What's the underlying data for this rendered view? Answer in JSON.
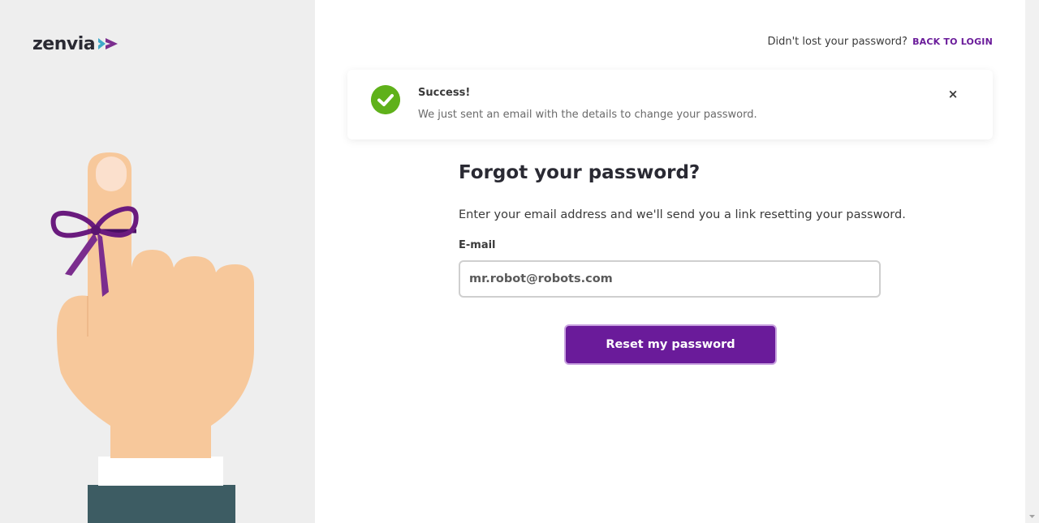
{
  "brand": {
    "name": "zenvia",
    "accent_color": "#6a1b9a",
    "arrow_colors": [
      "#3fa9c9",
      "#7b2d8e"
    ]
  },
  "header": {
    "question": "Didn't lost your password?",
    "back_link": "BACK TO LOGIN"
  },
  "alert": {
    "title": "Success!",
    "message": "We just sent an email with the details to change your password.",
    "icon": "check-circle-icon",
    "icon_color": "#5fb11a",
    "close_glyph": "×"
  },
  "form": {
    "title": "Forgot your password?",
    "description": "Enter your email address and we'll send you a link resetting your password.",
    "email_label": "E-mail",
    "email_value": "mr.robot@robots.com",
    "submit_label": "Reset my password"
  }
}
